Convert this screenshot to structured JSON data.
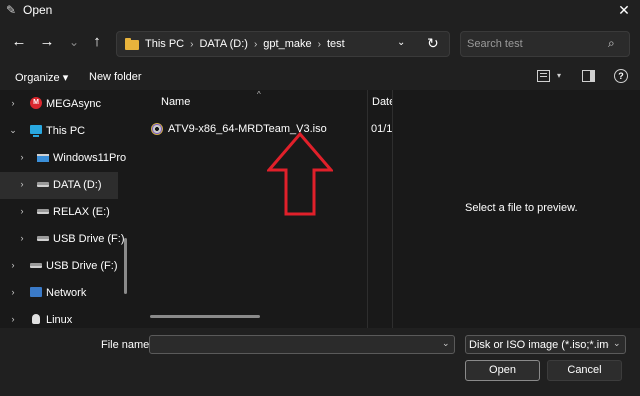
{
  "window": {
    "title": "Open",
    "close_glyph": "✕",
    "app_icon": "edit-icon"
  },
  "nav": {
    "back_glyph": "←",
    "forward_glyph": "→",
    "recent_glyph": "⌄",
    "up_glyph": "↑",
    "refresh_glyph": "↻",
    "dropdown_glyph": "⌄"
  },
  "address": {
    "crumbs": [
      "This PC",
      "DATA (D:)",
      "gpt_make",
      "test"
    ],
    "separator": "›"
  },
  "search": {
    "placeholder": "Search test",
    "icon_glyph": "⌕"
  },
  "toolbar": {
    "organize_label": "Organize ▾",
    "new_folder_label": "New folder",
    "view_dropdown_glyph": "▾",
    "help_glyph": "?"
  },
  "sidebar": {
    "items": [
      {
        "label": "MEGAsync",
        "icon": "megasync-icon",
        "chevron": "›",
        "mega_letter": "M"
      },
      {
        "label": "This PC",
        "icon": "this-pc-icon",
        "chevron": "⌄"
      },
      {
        "label": "Windows11Pro",
        "icon": "windows-drive-icon",
        "chevron": "›"
      },
      {
        "label": "DATA (D:)",
        "icon": "drive-icon",
        "chevron": "›",
        "selected": true
      },
      {
        "label": "RELAX (E:)",
        "icon": "drive-icon",
        "chevron": "›"
      },
      {
        "label": "USB Drive (F:)",
        "icon": "drive-icon",
        "chevron": "›"
      },
      {
        "label": "USB Drive (F:)",
        "icon": "drive-icon",
        "chevron": "›"
      },
      {
        "label": "Network",
        "icon": "network-icon",
        "chevron": "›"
      },
      {
        "label": "Linux",
        "icon": "linux-icon",
        "chevron": "›"
      }
    ]
  },
  "file_list": {
    "columns": {
      "name": "Name",
      "date": "Date"
    },
    "sort_glyph": "^",
    "rows": [
      {
        "name": "ATV9-x86_64-MRDTeam_V3.iso",
        "date": "01/1",
        "icon": "iso-file-icon"
      }
    ],
    "annotation_color": "#e0202a"
  },
  "preview": {
    "message": "Select a file to preview."
  },
  "bottom": {
    "file_name_label": "File name:",
    "file_name_value": "",
    "dropdown_glyph": "⌄",
    "file_type": "Disk or ISO image (*.iso;*.img;*.",
    "open_label": "Open",
    "cancel_label": "Cancel"
  }
}
